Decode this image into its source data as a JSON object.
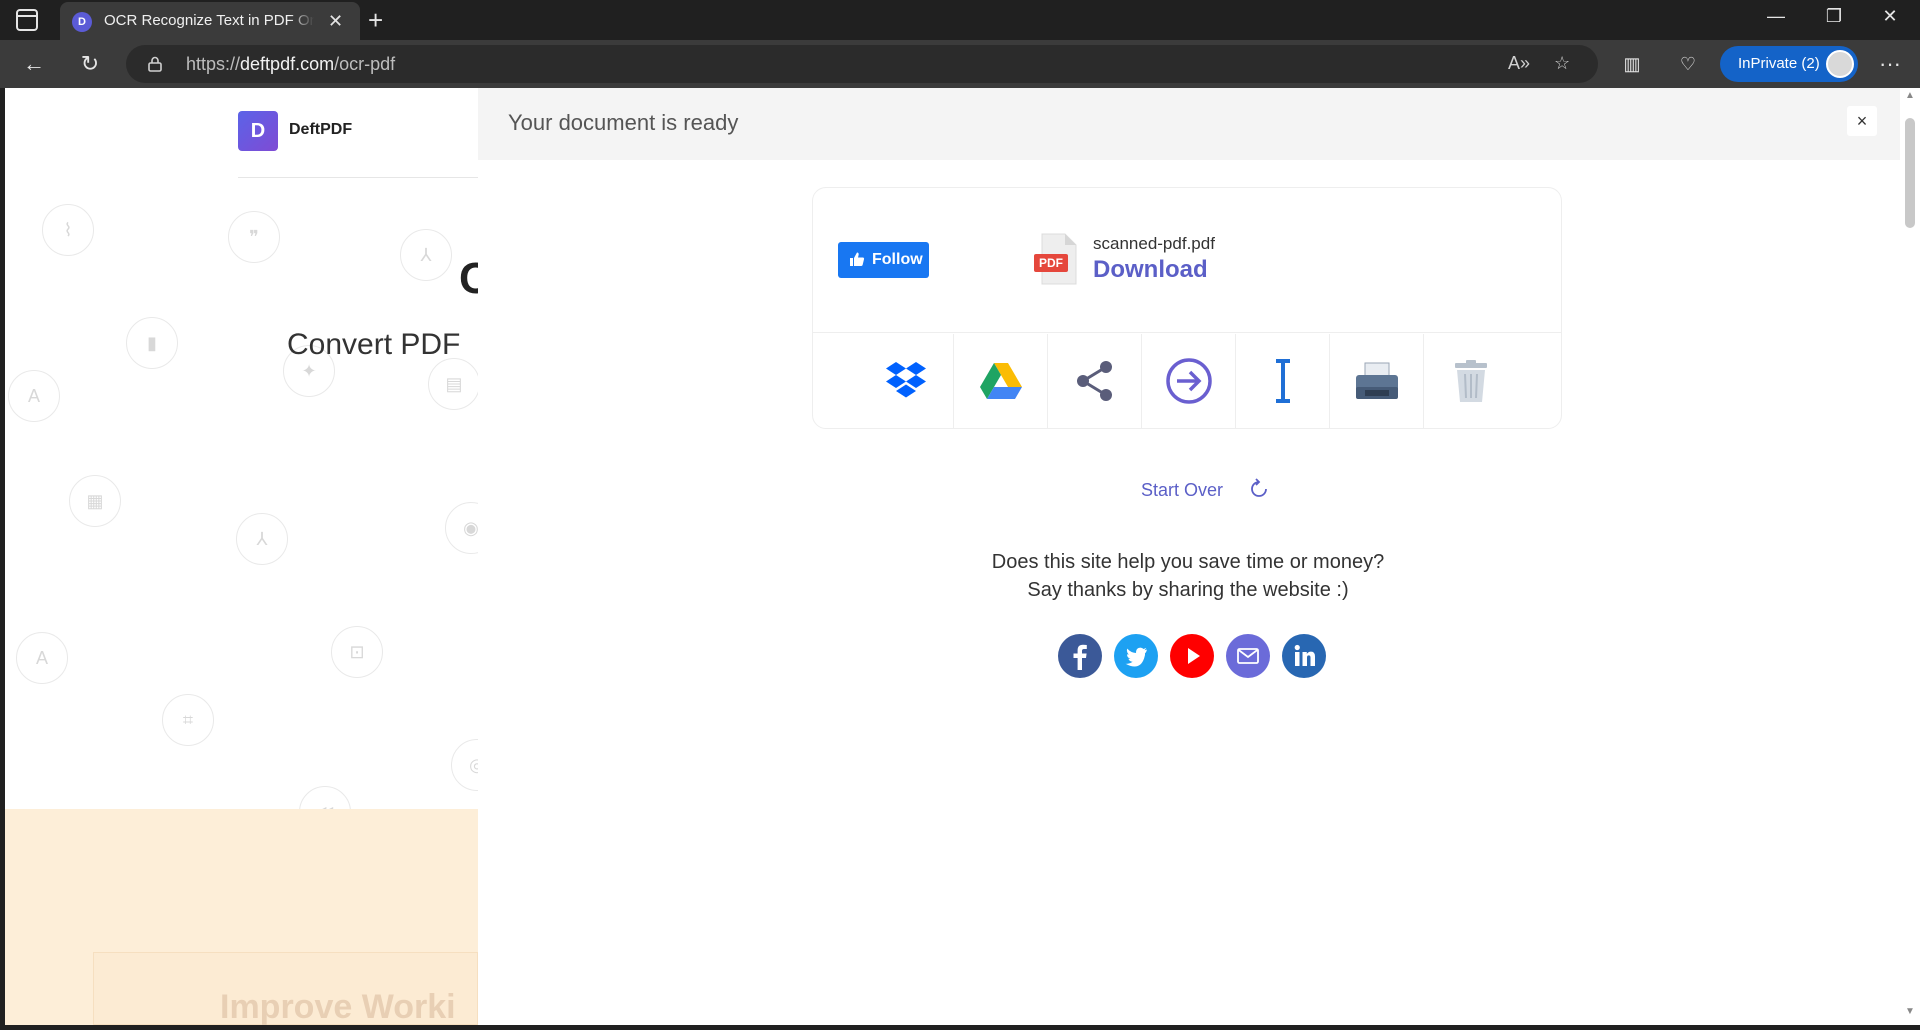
{
  "browser": {
    "tab_title": "OCR Recognize Text in PDF Online",
    "tab_favicon_letter": "D",
    "url_scheme": "https://",
    "url_host": "deftpdf.com",
    "url_path": "/ocr-pdf",
    "profile_label": "InPrivate (2)",
    "icons": [
      "sidebar-icon",
      "close-icon",
      "plus-icon",
      "back-icon",
      "refresh-icon",
      "lock-icon",
      "read-aloud-icon",
      "favorite-icon",
      "split-screen-icon",
      "heart-pulse-icon",
      "more-icon"
    ]
  },
  "background_page": {
    "logo_letter": "D",
    "brand": "DeftPDF",
    "heading_letter": "C",
    "heading": "Convert PDF",
    "footer_heading": "Improve Worki",
    "colors": {
      "peach": "#fdeed8"
    }
  },
  "panel": {
    "title": "Your document is ready",
    "close_label": "×",
    "follow_label": "Follow",
    "file_badge": "PDF",
    "filename": "scanned-pdf.pdf",
    "download_label": "Download",
    "actions": [
      "dropbox-icon",
      "google-drive-icon",
      "share-icon",
      "continue-icon",
      "edit-text-icon",
      "print-icon",
      "delete-icon"
    ],
    "start_over_label": "Start Over",
    "thanks_line1": "Does this site help you save time or money?",
    "thanks_line2": "Say thanks by sharing the website :)",
    "socials": [
      "facebook-icon",
      "twitter-icon",
      "youtube-icon",
      "email-icon",
      "linkedin-icon"
    ],
    "colors": {
      "accent": "#5b5fc7",
      "facebook": "#3b5998",
      "twitter": "#1da1f2",
      "youtube": "#ff0000",
      "email": "#6b6bd9",
      "linkedin": "#2867b2"
    }
  }
}
